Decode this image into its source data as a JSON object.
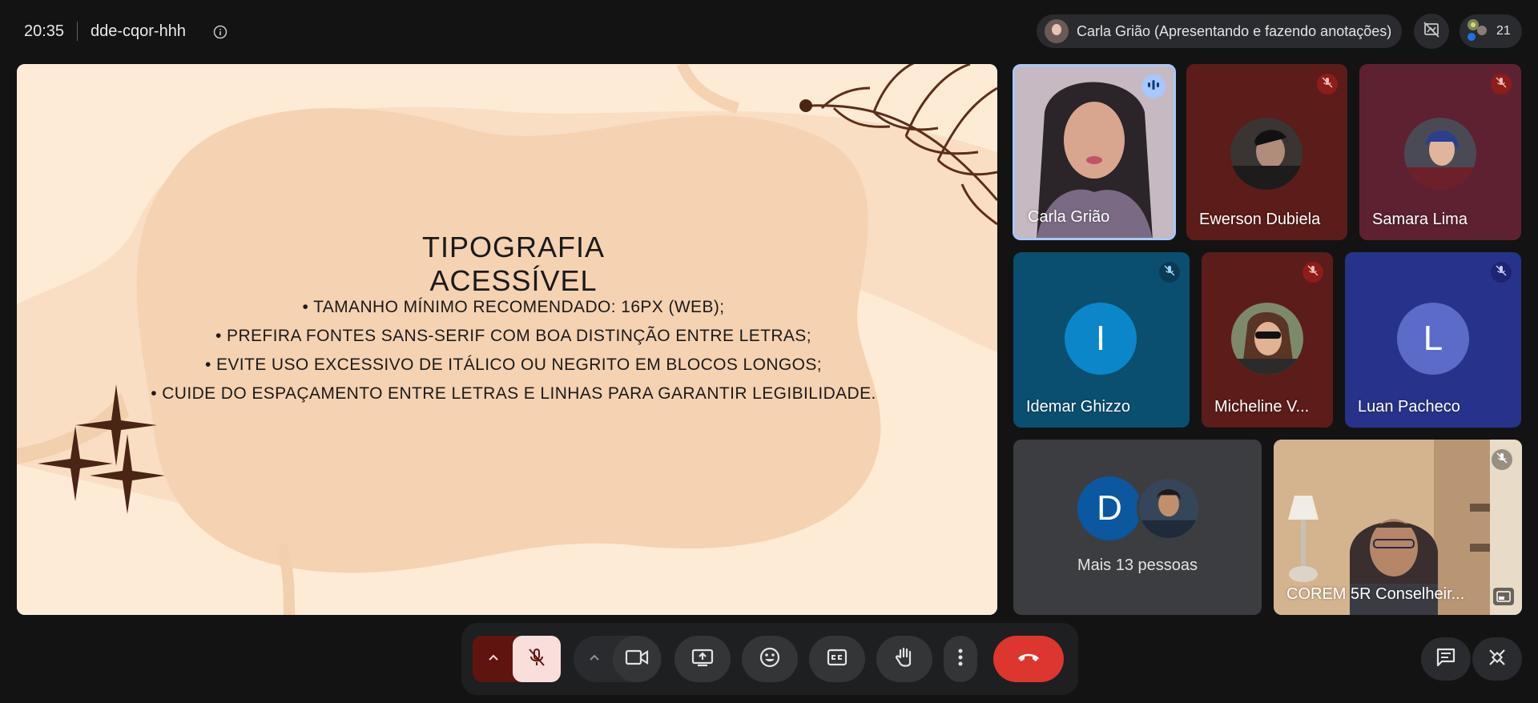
{
  "topbar": {
    "time": "20:35",
    "meeting_code": "dde-cqor-hhh",
    "presenter_label": "Carla Grião (Apresentando e fazendo anotações)",
    "participant_count": "21"
  },
  "slide": {
    "title": "TIPOGRAFIA ACESSÍVEL",
    "bullets": [
      "• TAMANHO MÍNIMO RECOMENDADO: 16PX (WEB);",
      "• PREFIRA FONTES SANS-SERIF COM BOA DISTINÇÃO ENTRE LETRAS;",
      "• EVITE USO EXCESSIVO DE ITÁLICO OU NEGRITO EM BLOCOS LONGOS;",
      "• CUIDE DO ESPAÇAMENTO ENTRE LETRAS E LINHAS PARA GARANTIR LEGIBILIDADE."
    ]
  },
  "participants": [
    {
      "name": "Carla Grião",
      "state": "speaking"
    },
    {
      "name": "Ewerson Dubiela",
      "state": "muted"
    },
    {
      "name": "Samara Lima",
      "state": "muted"
    },
    {
      "name": "Idemar Ghizzo",
      "initial": "I",
      "state": "muted"
    },
    {
      "name": "Micheline V...",
      "state": "muted"
    },
    {
      "name": "Luan Pacheco",
      "initial": "L",
      "state": "muted"
    },
    {
      "name": "COREM 5R Conselheir...",
      "state": "muted"
    }
  ],
  "others": {
    "label": "Mais 13 pessoas",
    "initial": "D"
  },
  "colors": {
    "background": "#131314",
    "hangup": "#dc362e",
    "mic_muted_bg": "#f9dedc",
    "speaking_border": "#a8c7fa"
  },
  "icons": {
    "mic": "mic-off-icon",
    "camera": "videocam-icon",
    "present": "present-to-all-icon",
    "reactions": "emoji-icon",
    "captions": "closed-caption-icon",
    "hand": "raise-hand-icon",
    "more": "more-vert-icon",
    "hangup": "call-end-icon",
    "chat": "chat-icon",
    "tools": "activities-icon"
  }
}
